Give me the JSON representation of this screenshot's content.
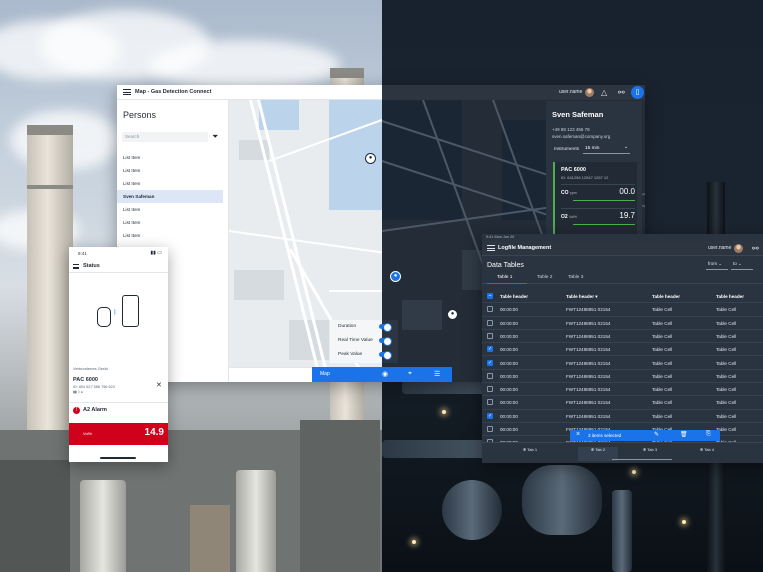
{
  "map_app": {
    "title": "Map - Gas Detection Connect",
    "user_label": "user.name",
    "persons_title": "Persons",
    "search_placeholder": "Search",
    "list": [
      "List Item",
      "List Item",
      "List Item",
      "Sven Safeman",
      "List Item",
      "List Item",
      "List Item"
    ],
    "selected_index": 3,
    "layers": [
      "Duration",
      "Real Time Value",
      "Peak Value"
    ],
    "bottom_label": "Map"
  },
  "person_card": {
    "name": "Sven Safeman",
    "phone": "+49 88 123 456 78",
    "email": "sven.safeman@company.org",
    "instruments_label": "Instruments",
    "instruments_value": "15 min",
    "device_name": "PAC 6000",
    "device_id": "ID: 641256 12547 1257 12",
    "gases": [
      {
        "name": "CO",
        "unit": "ppm",
        "value": "00.0"
      },
      {
        "name": "O2",
        "unit": "Vol%",
        "value": "19.7"
      }
    ]
  },
  "phone": {
    "time": "9:41",
    "title": "Status",
    "connected_label": "Verbundenes Gerät",
    "device_name": "PAC 6000",
    "device_id": "ID: 804 627 588 756 623",
    "alarm_label": "A2 Alarm",
    "gas_label": "Vol%",
    "gas_value": "14.9"
  },
  "logfile": {
    "status_time": "9:41 Mon Jun 20",
    "title": "Logfile Management",
    "user_label": "user.name",
    "heading": "Data Tables",
    "from_label": "from",
    "to_label": "to",
    "tabs": [
      "Table 1",
      "Table 2",
      "Table 3"
    ],
    "columns": [
      "Table header",
      "Table header",
      "Table header",
      "Table header"
    ],
    "rows": [
      {
        "checked": false,
        "time": "00:00:00",
        "id": "FWT12488951 02154",
        "c3": "Table Cell",
        "c4": "Table Cell"
      },
      {
        "checked": false,
        "time": "00:00:00",
        "id": "FWT12488951 02154",
        "c3": "Table Cell",
        "c4": "Table Cell"
      },
      {
        "checked": false,
        "time": "00:00:00",
        "id": "FWT12488951 02154",
        "c3": "Table Cell",
        "c4": "Table Cell"
      },
      {
        "checked": true,
        "time": "00:00:00",
        "id": "FWT12488951 02154",
        "c3": "Table Cell",
        "c4": "Table Cell"
      },
      {
        "checked": true,
        "time": "00:00:00",
        "id": "FWT12488951 02154",
        "c3": "Table Cell",
        "c4": "Table Cell"
      },
      {
        "checked": false,
        "time": "00:00:00",
        "id": "FWT12488951 02154",
        "c3": "Table Cell",
        "c4": "Table Cell"
      },
      {
        "checked": false,
        "time": "00:00:00",
        "id": "FWT12488951 02154",
        "c3": "Table Cell",
        "c4": "Table Cell"
      },
      {
        "checked": false,
        "time": "00:00:00",
        "id": "FWT12488951 02154",
        "c3": "Table Cell",
        "c4": "Table Cell"
      },
      {
        "checked": true,
        "time": "00:00:00",
        "id": "FWT12488951 02154",
        "c3": "Table Cell",
        "c4": "Table Cell"
      },
      {
        "checked": false,
        "time": "00:00:00",
        "id": "FWT12488951 02154",
        "c3": "Table Cell",
        "c4": "Table Cell"
      },
      {
        "checked": false,
        "time": "00:00:00",
        "id": "FWT12488951 02154",
        "c3": "Table Cell",
        "c4": "Table Cell"
      }
    ],
    "selection_label": "3 items selected",
    "bottom_tabs": [
      "Tab 1",
      "Tab 2",
      "Tab 3",
      "Tab 4"
    ],
    "active_bottom_tab": 1
  },
  "colors": {
    "accent": "#1a73e8",
    "alarm": "#d0021b",
    "dark_panel": "#2a3340"
  }
}
